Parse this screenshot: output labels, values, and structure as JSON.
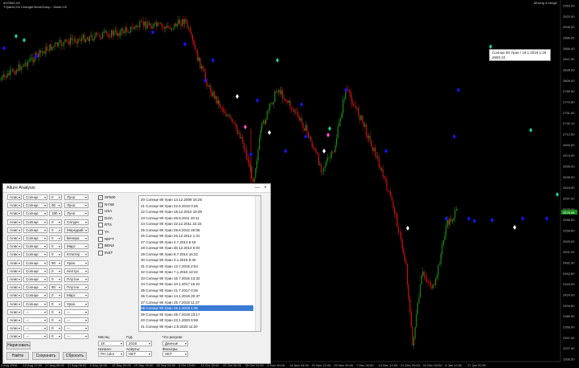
{
  "chart_header": {
    "symbol": "#US500,H4",
    "indicator": "TYpanel,On ChangeCheckGroup - Value=15",
    "mode": "Moving 4 merge"
  },
  "tooltip": {
    "line1": "Солнце 90 Уран / 19.1.2019 1:25",
    "line2": "2693.10"
  },
  "price_axis": [
    "2963.00",
    "2923.50",
    "2905.00",
    "2886.00",
    "2866.40",
    "2847.50",
    "2828.00",
    "2809.00",
    "2789.50",
    "2770.60",
    "2751.00",
    "2732.10",
    "2712.50",
    "2693.50",
    "2674.00",
    "2655.00",
    "2635.00",
    "2616.50",
    "2597.00",
    "2578.00",
    "2558.50",
    "2539.60",
    "2520.00",
    "2501.00",
    "2481.50",
    "2462.60",
    "2443.00",
    "2424.00",
    "2404.60",
    "2385.50",
    "2366.00",
    "2347.00",
    "2327.50",
    "2308.50"
  ],
  "current_price": "2575.68",
  "time_axis": [
    "1 Aug 2018",
    "10 Aug 12:00",
    "17 Aug 08:00",
    "27 Aug 08:00",
    "4 Sep 16:00",
    "12 Sep 00:00",
    "19 Sep 20:00",
    "28 Sep 04:00",
    "5 Oct 12:00",
    "12 Oct 20:00",
    "22 Oct 04:00",
    "29 Oct 12:00",
    "5 Nov 20:00",
    "14 Nov 04:00",
    "21 Nov 12:00",
    "29 Nov 20:00",
    "7 Dec 04:00",
    "14 Dec 12:00",
    "21 Dec 20:00",
    "31 Dec 04:00",
    "8 Jan 12:00",
    "17 Jan 20:00"
  ],
  "colors": {
    "bull": "#1a8a1a",
    "bear": "#c81414",
    "marker_blue": "#1414ff",
    "marker_green": "#14d2a0",
    "marker_white": "#ffffff",
    "marker_pink": "#ff50c8",
    "selection": "#3a7bd5"
  },
  "dialog": {
    "title": "Allure Analysis",
    "minimize": "—",
    "close": "×",
    "rows": [
      {
        "a": "Алис",
        "p": "Солнце",
        "ang": "0",
        "t": "Луна"
      },
      {
        "a": "Алис",
        "p": "Солнце",
        "ang": "90",
        "t": "Луна"
      },
      {
        "a": "Алис",
        "p": "Солнце",
        "ang": "180",
        "t": "Луна"
      },
      {
        "a": "Алис",
        "p": "Солнце",
        "ang": "0",
        "t": "Сатурн"
      },
      {
        "a": "Алис",
        "p": "Солнце",
        "ang": "0",
        "t": "Меркурий"
      },
      {
        "a": "Алис",
        "p": "Солнце",
        "ang": "0",
        "t": "Венера"
      },
      {
        "a": "Алис",
        "p": "Солнце",
        "ang": "0",
        "t": "Марс"
      },
      {
        "a": "Алис",
        "p": "Солнце",
        "ang": "0",
        "t": "Юпитер"
      },
      {
        "a": "Алис",
        "p": "Солнце",
        "ang": "90",
        "t": "Уран"
      },
      {
        "a": "Алис",
        "p": "Солнце",
        "ang": "0",
        "t": "Нептун"
      },
      {
        "a": "Алис",
        "p": "Солнце",
        "ang": "0",
        "t": "Плутон"
      },
      {
        "a": "Алис",
        "p": "Солнце",
        "ang": "90",
        "t": "Плутон"
      },
      {
        "a": "Алис",
        "p": "Солнце",
        "ang": "0",
        "t": "Марс"
      },
      {
        "a": "Алис",
        "p": "Солнце",
        "ang": "0",
        "t": "Уран"
      },
      {
        "a": "Алис",
        "p": "---",
        "ang": "0",
        "t": "---"
      },
      {
        "a": "Алис",
        "p": "---",
        "ang": "0",
        "t": "---"
      },
      {
        "a": "Алис",
        "p": "---",
        "ang": "0",
        "t": "---"
      },
      {
        "a": "Алис",
        "p": "---",
        "ang": "0",
        "t": "---"
      }
    ],
    "indices": [
      {
        "label": "SP500",
        "checked": true
      },
      {
        "label": "NYSE",
        "checked": true
      },
      {
        "label": "USA",
        "checked": true
      },
      {
        "label": "DJIA",
        "checked": true
      },
      {
        "label": "RTS",
        "checked": false
      },
      {
        "label": "YA",
        "checked": false
      },
      {
        "label": "NEFT",
        "checked": false
      },
      {
        "label": "BENZ",
        "checked": false
      },
      {
        "label": "INST",
        "checked": false
      }
    ],
    "list": [
      "20 Солнце 90 Уран 14.12.2009 15:25",
      "21 Солнце 90 Уран 22.6.2010 0:25",
      "22 Солнце 90 Уран 18.12.2010 18:49",
      "23 Солнце 90 Уран 26.6.2011 10:11",
      "24 Солнце 90 Уран 22.12.2011 22:15",
      "25 Солнце 90 Уран 29.6.2012 20:06",
      "26 Солнце 90 Уран 26.12.2012 1:31",
      "27 Солнце 90 Уран 4.7.2013 6:18",
      "28 Солнце 90 Уран 30.12.2013 5:04",
      "29 Солнце 90 Уран 8.7.2014 16:22",
      "30 Солнце 90 Уран 3.1.2015 8:40",
      "31 Солнце 90 Уран 12.7.2015 2:54",
      "32 Солнце 90 Уран 7.1.2016 12:22",
      "33 Солнце 90 Уран 16.7.2016 13:32",
      "34 Солнце 90 Уран 10.1.2017 16:22",
      "35 Солнце 90 Уран 21.7.2017 0:26",
      "36 Солнце 90 Уран 14.1.2018 20:47",
      "37 Солнце 90 Уран 25.7.2018 11:37",
      "38 Солнце 90 Уран 19.1.2019 1:35",
      "39 Солнце 90 Уран 29.7.2019 23:17",
      "40 Солнце 90 Уран 23.1.2020 6:58",
      "41 Солнце 90 Уран 2.8.2020 11:20"
    ],
    "selected_index": 18,
    "month_label": "Месяц:",
    "month_value": "18",
    "year_label": "Год:",
    "year_value": "2018",
    "draw_label": "Что рисуем:",
    "draw_value": "Данные",
    "start_label": "Начало:",
    "start_value": "PH color",
    "alerts_label": "Алерты:",
    "alerts_value": "НЕТ",
    "filters_label": "Фильтры:",
    "filters_value": "НЕТ",
    "btn_draw": "Нарисовать",
    "btn_find": "Найти",
    "btn_save": "Сохранить",
    "btn_reset": "Сбросить"
  }
}
